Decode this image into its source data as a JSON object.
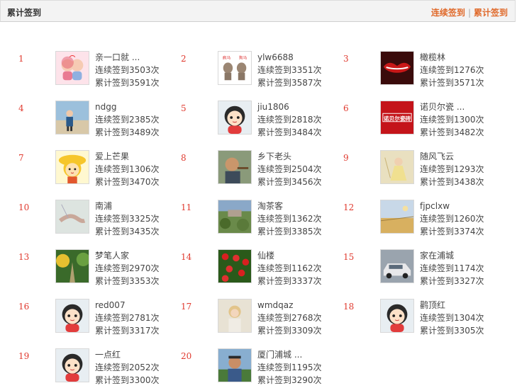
{
  "header": {
    "title": "累计签到",
    "tab_continuous": "连续签到",
    "tab_separator": "|",
    "tab_total": "累计签到"
  },
  "labels": {
    "continuous_prefix": "连续签到",
    "total_prefix": "累计签到",
    "unit": "次"
  },
  "entries": [
    {
      "rank": "1",
      "name": "亲一口就 ...",
      "continuous": "连续签到3503次",
      "total": "累计签到3591次",
      "avatar": "kiss-couple-avatar"
    },
    {
      "rank": "2",
      "name": "ylw6688",
      "continuous": "连续签到3351次",
      "total": "累计签到3587次",
      "avatar": "rats-avatar"
    },
    {
      "rank": "3",
      "name": "橄榄林",
      "continuous": "连续签到1276次",
      "total": "累计签到3571次",
      "avatar": "red-lips-avatar"
    },
    {
      "rank": "4",
      "name": "ndgg",
      "continuous": "连续签到2385次",
      "total": "累计签到3489次",
      "avatar": "beach-child-avatar"
    },
    {
      "rank": "5",
      "name": "jiu1806",
      "continuous": "连续签到2818次",
      "total": "累计签到3484次",
      "avatar": "default-cartoon-avatar"
    },
    {
      "rank": "6",
      "name": "诺贝尔瓷 ...",
      "continuous": "连续签到1300次",
      "total": "累计签到3482次",
      "avatar": "nobel-logo-avatar"
    },
    {
      "rank": "7",
      "name": "爱上芒果",
      "continuous": "连续签到1306次",
      "total": "累计签到3470次",
      "avatar": "yellow-girl-avatar"
    },
    {
      "rank": "8",
      "name": "乡下老头",
      "continuous": "连续签到2504次",
      "total": "累计签到3456次",
      "avatar": "old-man-avatar"
    },
    {
      "rank": "9",
      "name": "随风飞云",
      "continuous": "连续签到1293次",
      "total": "累计签到3438次",
      "avatar": "dreamy-girl-avatar"
    },
    {
      "rank": "10",
      "name": "南浦",
      "continuous": "连续签到3325次",
      "total": "累计签到3435次",
      "avatar": "hands-avatar"
    },
    {
      "rank": "11",
      "name": "淘茶客",
      "continuous": "连续签到1362次",
      "total": "累计签到3385次",
      "avatar": "garden-avatar"
    },
    {
      "rank": "12",
      "name": "fjpclxw",
      "continuous": "连续签到1260次",
      "total": "累计签到3374次",
      "avatar": "meadow-avatar"
    },
    {
      "rank": "13",
      "name": "梦笔人家",
      "continuous": "连续签到2970次",
      "total": "累计签到3353次",
      "avatar": "forest-road-avatar"
    },
    {
      "rank": "14",
      "name": "仙楼",
      "continuous": "连续签到1162次",
      "total": "累计签到3337次",
      "avatar": "red-flowers-avatar"
    },
    {
      "rank": "15",
      "name": "家在浦城",
      "continuous": "连续签到1174次",
      "total": "累计签到3327次",
      "avatar": "car-avatar"
    },
    {
      "rank": "16",
      "name": "red007",
      "continuous": "连续签到2781次",
      "total": "累计签到3317次",
      "avatar": "default-cartoon-avatar"
    },
    {
      "rank": "17",
      "name": "wmdqaz",
      "continuous": "连续签到2768次",
      "total": "累计签到3309次",
      "avatar": "blonde-girl-avatar"
    },
    {
      "rank": "18",
      "name": "鹳顶红",
      "continuous": "连续签到1304次",
      "total": "累计签到3305次",
      "avatar": "default-cartoon-avatar"
    },
    {
      "rank": "19",
      "name": "一点红",
      "continuous": "连续签到2052次",
      "total": "累计签到3300次",
      "avatar": "default-cartoon-avatar"
    },
    {
      "rank": "20",
      "name": "厦门浦城 ...",
      "continuous": "连续签到1195次",
      "total": "累计签到3290次",
      "avatar": "man-photo-avatar"
    }
  ],
  "colors": {
    "accent": "#e06a2b",
    "rank": "#e03a2f",
    "header_bg": "#f3f3f3"
  }
}
